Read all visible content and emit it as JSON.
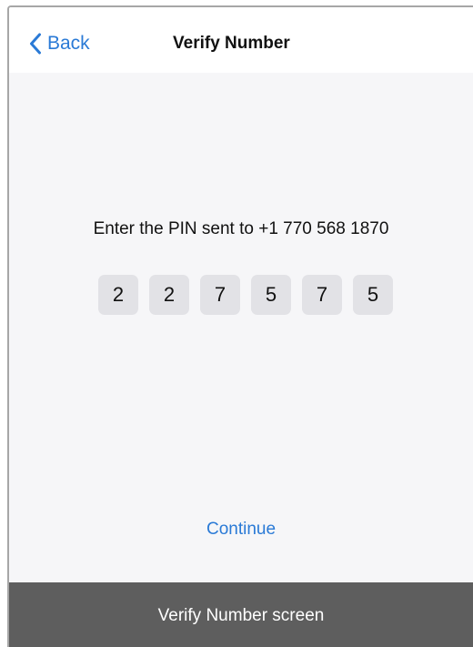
{
  "navbar": {
    "back_label": "Back",
    "title": "Verify Number"
  },
  "verify": {
    "prompt": "Enter the PIN sent to +1 770 568 1870",
    "pin_digits": [
      "2",
      "2",
      "7",
      "5",
      "7",
      "5"
    ],
    "continue_label": "Continue"
  },
  "caption": {
    "text": "Verify Number screen"
  },
  "colors": {
    "accent": "#2a7ad6",
    "background": "#f6f6f8",
    "pin_box": "#e2e2e6",
    "caption_bar": "#5e5e5e"
  },
  "icons": {
    "back": "chevron-left-icon"
  }
}
